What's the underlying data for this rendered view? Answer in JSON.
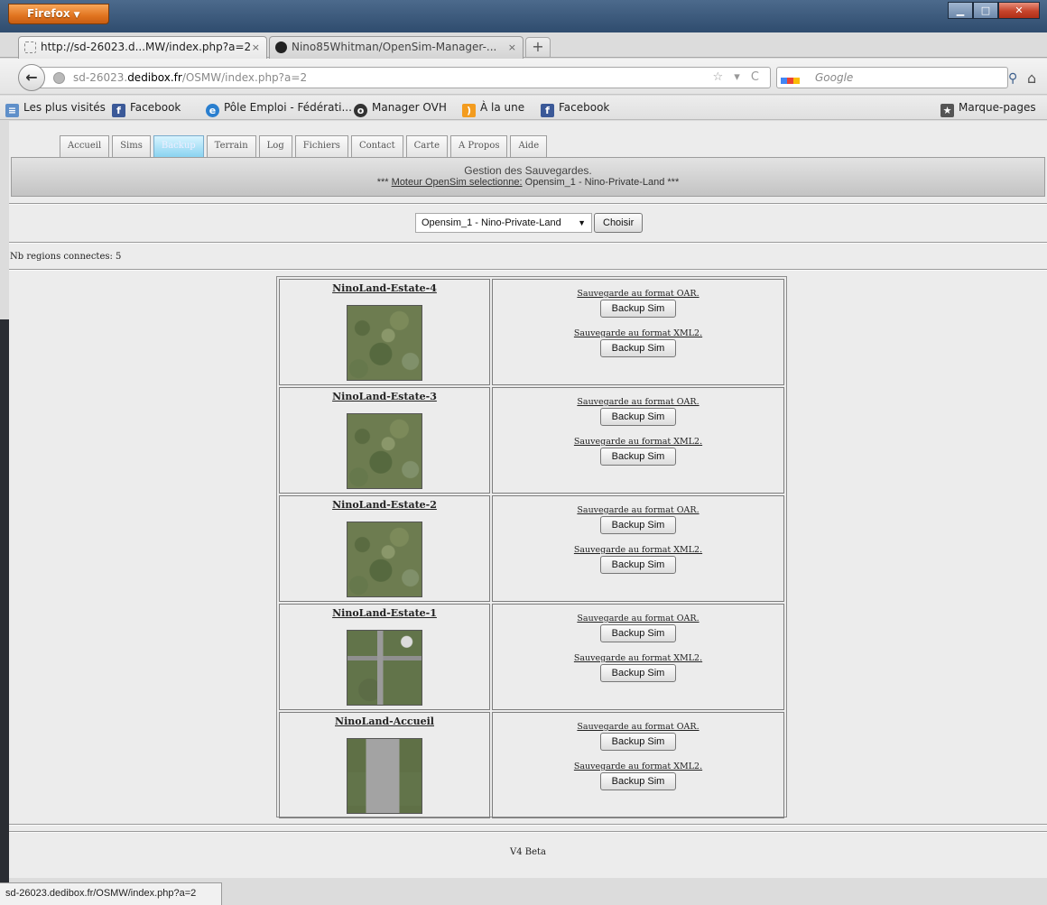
{
  "browser": {
    "menu_label": "Firefox",
    "menu_arrow": "▼",
    "controls": {
      "minimize": "▁",
      "maximize": "□",
      "close": "✕"
    },
    "tabs": [
      {
        "label": "http://sd-26023.d...MW/index.php?a=2",
        "close": "×",
        "active": true,
        "icon": "page-icon"
      },
      {
        "label": "Nino85Whitman/OpenSim-Manager-...",
        "close": "×",
        "active": false,
        "icon": "github-icon"
      }
    ],
    "new_tab": "+",
    "url": {
      "pre": "sd-26023.",
      "domain": "dedibox.fr",
      "post": "/OSMW/index.php?a=2"
    },
    "url_icons": "☆ ▾ C",
    "search": {
      "placeholder": "Google"
    },
    "bookmarks": [
      {
        "label": "Les plus visités",
        "icon": "most-visited-icon"
      },
      {
        "label": "Facebook",
        "icon": "facebook-icon"
      },
      {
        "label": "Pôle Emploi - Fédérati...",
        "icon": "pole-emploi-icon"
      },
      {
        "label": "Manager OVH",
        "icon": "ovh-icon"
      },
      {
        "label": "À la une",
        "icon": "rss-icon"
      },
      {
        "label": "Facebook",
        "icon": "facebook-icon"
      }
    ],
    "bookmarks_menu": "Marque-pages",
    "status": "sd-26023.dedibox.fr/OSMW/index.php?a=2"
  },
  "site": {
    "tabs": [
      "Accueil",
      "Sims",
      "Backup",
      "Terrain",
      "Log",
      "Fichiers",
      "Contact",
      "Carte",
      "A Propos",
      "Aide"
    ],
    "active_tab": "Backup",
    "banner": {
      "title": "Gestion des Sauvegardes.",
      "engine_prefix": "***",
      "engine_label": "Moteur OpenSim selectionne:",
      "engine_value": "Opensim_1 - Nino-Private-Land",
      "engine_suffix": "***"
    },
    "selector": {
      "value": "Opensim_1 - Nino-Private-Land",
      "button": "Choisir"
    },
    "regions_count_label": "Nb regions connectes: 5",
    "oar_label": "Sauvegarde au format OAR.",
    "xml_label": "Sauvegarde au format XML2.",
    "backup_button": "Backup Sim",
    "regions": [
      {
        "name": "NinoLand-Estate-4",
        "map": "grass"
      },
      {
        "name": "NinoLand-Estate-3",
        "map": "grass"
      },
      {
        "name": "NinoLand-Estate-2",
        "map": "grass"
      },
      {
        "name": "NinoLand-Estate-1",
        "map": "city"
      },
      {
        "name": "NinoLand-Accueil",
        "map": "town"
      }
    ],
    "footer": "V4 Beta"
  }
}
